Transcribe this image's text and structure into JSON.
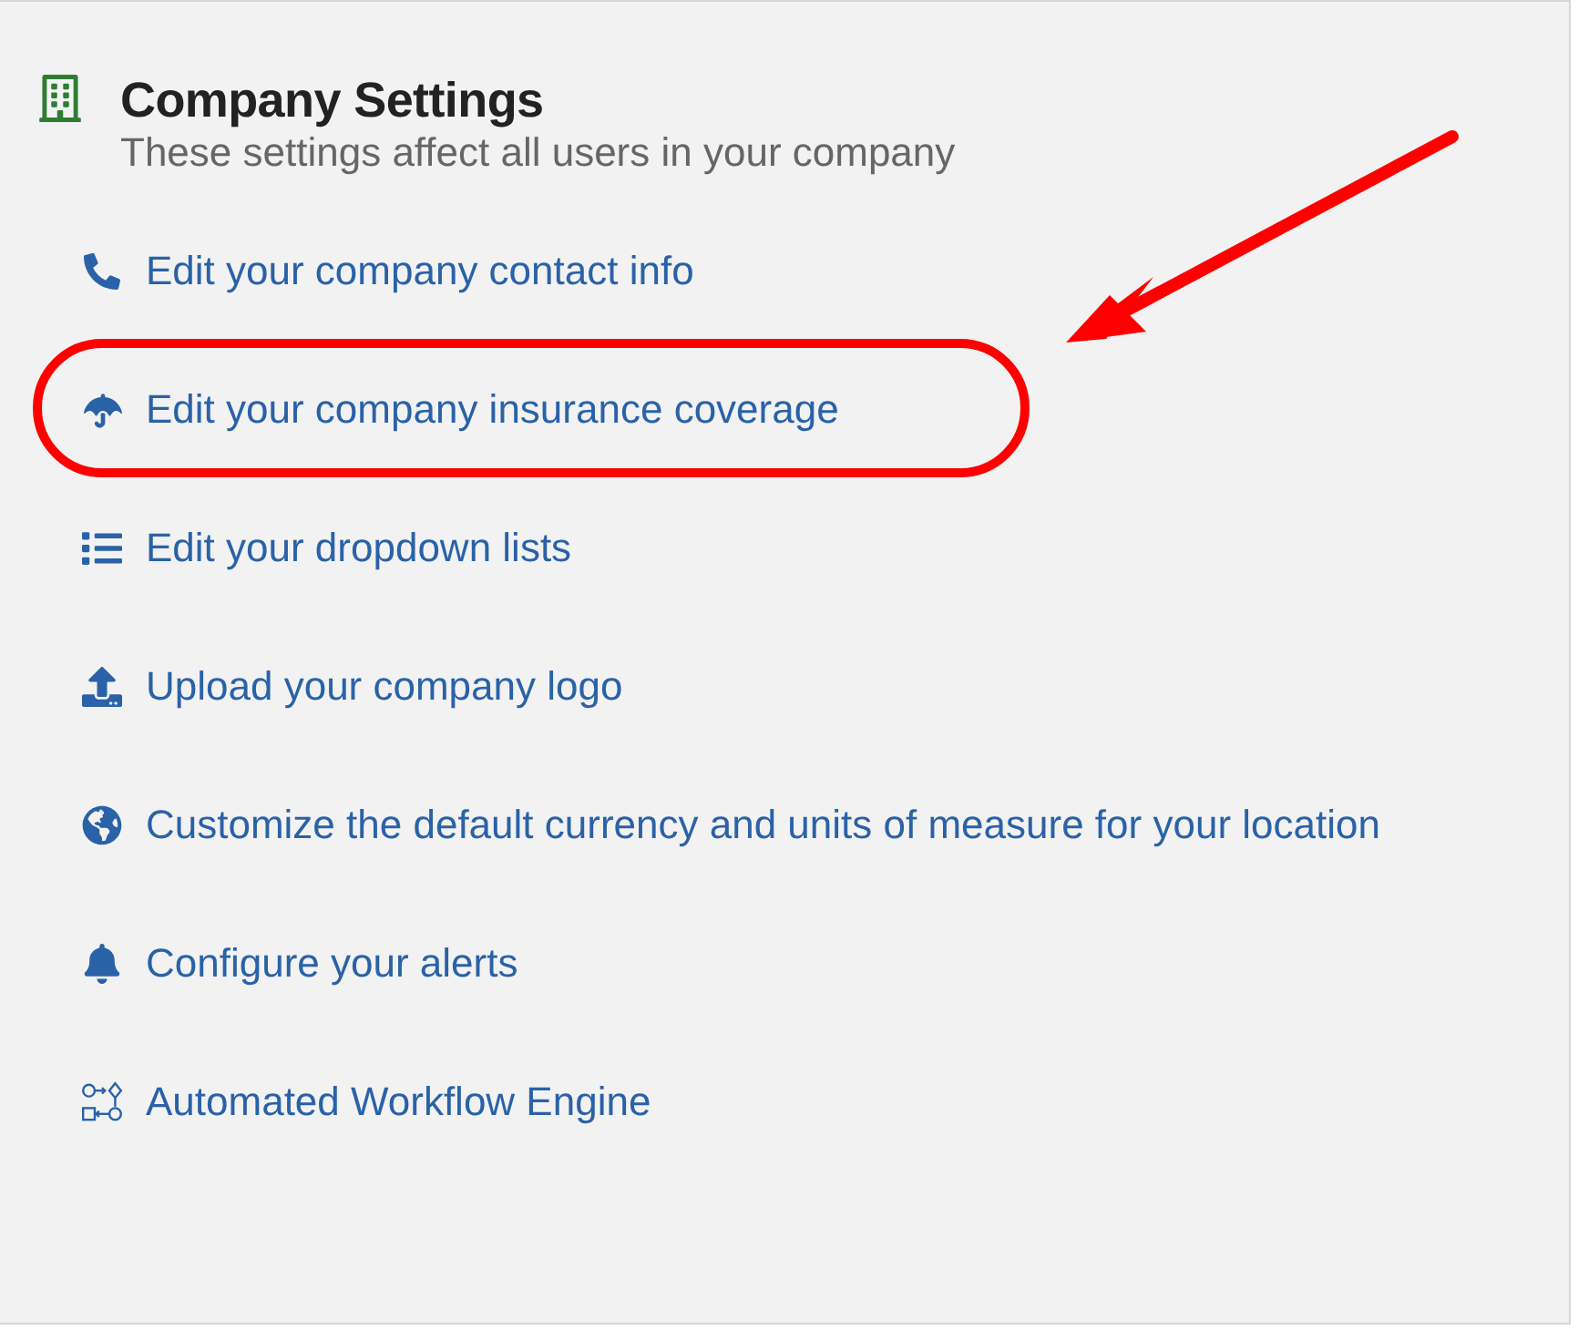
{
  "header": {
    "title": "Company Settings",
    "subtitle": "These settings affect all users in your company"
  },
  "links": [
    {
      "label": "Edit your company contact info",
      "circled": false
    },
    {
      "label": "Edit your company insurance coverage",
      "circled": true
    },
    {
      "label": "Edit your dropdown lists",
      "circled": false
    },
    {
      "label": "Upload your company logo",
      "circled": false
    },
    {
      "label": "Customize the default currency and units of measure for your location",
      "circled": false
    },
    {
      "label": "Configure your alerts",
      "circled": false
    },
    {
      "label": "Automated Workflow Engine",
      "circled": false
    }
  ]
}
